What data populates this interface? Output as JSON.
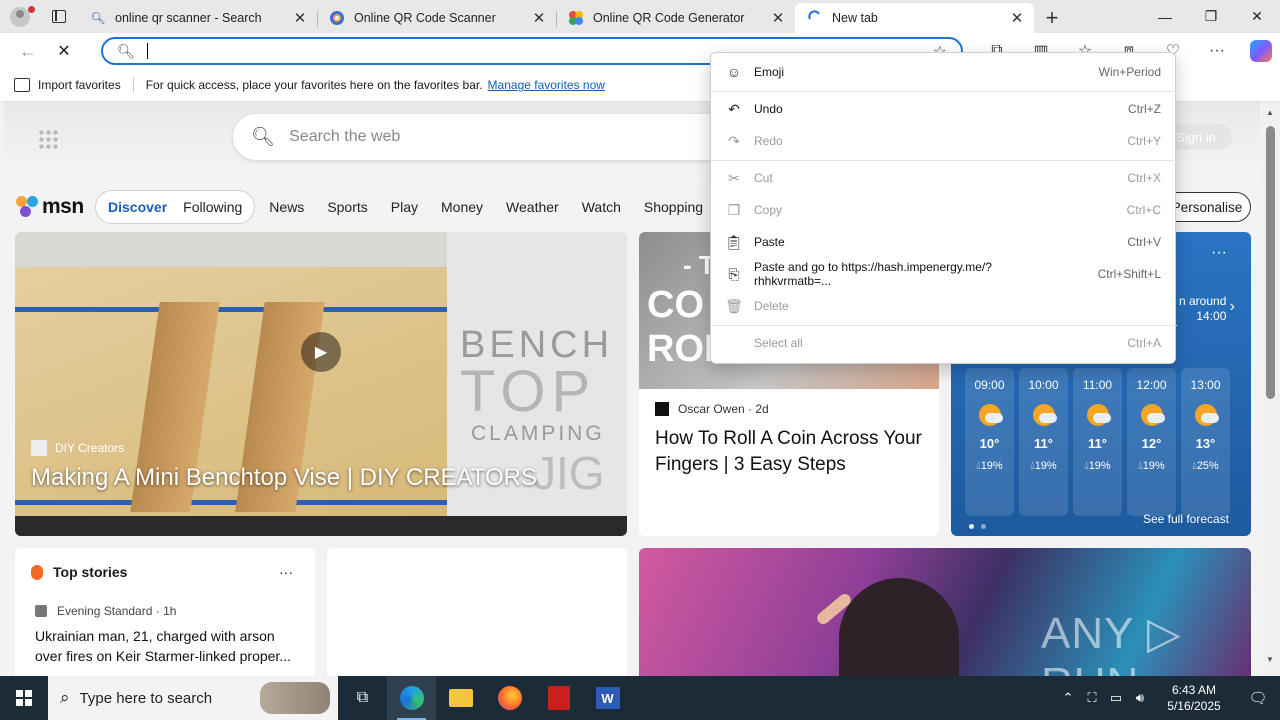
{
  "browser": {
    "tabs": [
      {
        "title": "online qr scanner - Search",
        "favicon": "search-icon",
        "active": false
      },
      {
        "title": "Online QR Code Scanner",
        "favicon": "qr-scanner-favicon",
        "active": false
      },
      {
        "title": "Online QR Code Generator",
        "favicon": "qr-generator-favicon",
        "active": false
      },
      {
        "title": "New tab",
        "favicon": "loading-icon",
        "active": true
      }
    ],
    "new_tab_symbol": "+",
    "window_controls": {
      "minimize": "—",
      "maximize": "❐",
      "close": "✕"
    },
    "address": {
      "value": "",
      "placeholder": ""
    },
    "accent": "#1a73d9"
  },
  "favorites_bar": {
    "import_label": "Import favorites",
    "message": "For quick access, place your favorites here on the favorites bar.",
    "manage_link": "Manage favorites now"
  },
  "newtab": {
    "search_placeholder": "Search the web",
    "sign_in": "Sign in",
    "msn": {
      "logo": "msn",
      "pills": [
        "Discover",
        "Following"
      ],
      "nav": [
        "News",
        "Sports",
        "Play",
        "Money",
        "Weather",
        "Watch",
        "Shopping"
      ],
      "personalise": "Personalise"
    },
    "video_card": {
      "source": "DIY Creators",
      "title": "Making A Mini Benchtop Vise | DIY CREATORS",
      "thumb_text": [
        "BENCH",
        "TOP",
        "CLAMPING",
        "JIG"
      ]
    },
    "coin_card": {
      "thumb_text": [
        "- TH",
        "CO",
        "ROLL"
      ],
      "source": "Oscar Owen",
      "age": "2d",
      "title": "How To Roll A Coin Across Your Fingers | 3 Easy Steps"
    },
    "weather_card": {
      "more": "···",
      "around_line1": "n around",
      "around_line2": "14:00",
      "hours": [
        {
          "time": "09:00",
          "temp": "10°",
          "precip": "19%"
        },
        {
          "time": "10:00",
          "temp": "11°",
          "precip": "19%"
        },
        {
          "time": "11:00",
          "temp": "11°",
          "precip": "19%"
        },
        {
          "time": "12:00",
          "temp": "12°",
          "precip": "19%"
        },
        {
          "time": "13:00",
          "temp": "13°",
          "precip": "25%"
        }
      ],
      "full_forecast": "See full forecast"
    },
    "top_stories": {
      "heading": "Top stories",
      "more": "···",
      "source": "Evening Standard",
      "age": "1h",
      "headline": "Ukrainian man, 21, charged with arson over fires on Keir Starmer-linked proper..."
    },
    "watermark": "ANY ▷ RUN"
  },
  "context_menu": {
    "items": [
      {
        "label": "Emoji",
        "shortcut": "Win+Period",
        "icon": "emoji-icon",
        "disabled": false
      },
      {
        "label": "Undo",
        "shortcut": "Ctrl+Z",
        "icon": "undo-icon",
        "disabled": false
      },
      {
        "label": "Redo",
        "shortcut": "Ctrl+Y",
        "icon": "redo-icon",
        "disabled": true
      },
      {
        "label": "Cut",
        "shortcut": "Ctrl+X",
        "icon": "cut-icon",
        "disabled": true
      },
      {
        "label": "Copy",
        "shortcut": "Ctrl+C",
        "icon": "copy-icon",
        "disabled": true
      },
      {
        "label": "Paste",
        "shortcut": "Ctrl+V",
        "icon": "paste-icon",
        "disabled": false
      },
      {
        "label": "Paste and go to https://hash.impenergy.me/?rhhkvrmatb=...",
        "shortcut": "Ctrl+Shift+L",
        "icon": "paste-go-icon",
        "disabled": false
      },
      {
        "label": "Delete",
        "shortcut": "",
        "icon": "delete-icon",
        "disabled": true
      },
      {
        "label": "Select all",
        "shortcut": "Ctrl+A",
        "icon": "",
        "disabled": true
      }
    ]
  },
  "taskbar": {
    "search_placeholder": "Type here to search",
    "time": "6:43 AM",
    "date": "5/16/2025"
  }
}
